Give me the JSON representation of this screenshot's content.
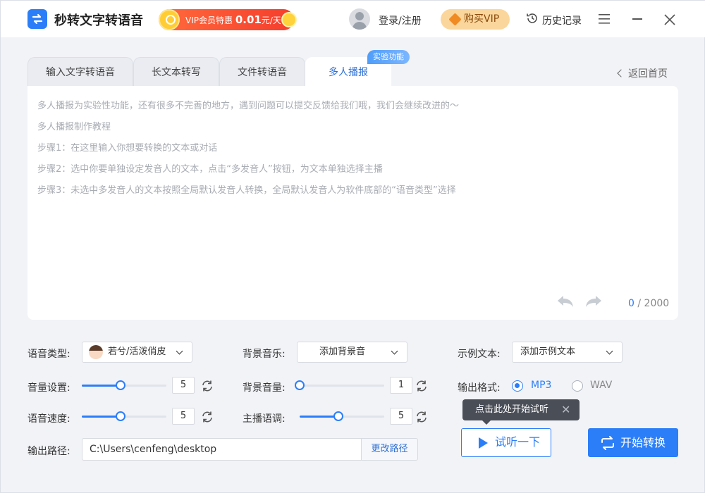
{
  "app": {
    "title": "秒转文字转语音",
    "promo_prefix": "VIP会员特惠",
    "promo_price": "0.01",
    "promo_suffix": "元/天",
    "login": "登录/注册",
    "buy_vip": "购买VIP",
    "history": "历史记录"
  },
  "tabs": [
    {
      "label": "输入文字转语音"
    },
    {
      "label": "长文本转写"
    },
    {
      "label": "文件转语音"
    },
    {
      "label": "多人播报"
    }
  ],
  "badge": "实验功能",
  "back": "返回首页",
  "editor": {
    "hints": [
      "多人播报为实验性功能，还有很多不完善的地方，遇到问题可以提交反馈给我们哦，我们会继续改进的～",
      "多人播报制作教程",
      "步骤1：在这里输入你想要转换的文本或对话",
      "步骤2：选中你要单独设定发音人的文本，点击“多发音人”按钮，为文本单独选择主播",
      "步骤3：未选中多发音人的文本按照全局默认发音人转换，全局默认发音人为软件底部的“语音类型”选择"
    ],
    "count_current": "0",
    "count_sep": " / ",
    "count_max": "2000"
  },
  "settings": {
    "voice_type_label": "语音类型:",
    "voice_type_value": "若兮/活泼俏皮",
    "bg_music_label": "背景音乐:",
    "bg_music_value": "添加背景音",
    "sample_text_label": "示例文本:",
    "sample_text_value": "添加示例文本",
    "volume_label": "音量设置:",
    "volume_value": "5",
    "bg_volume_label": "背景音量:",
    "bg_volume_value": "1",
    "output_format_label": "输出格式:",
    "format_mp3": "MP3",
    "format_wav": "WAV",
    "speed_label": "语音速度:",
    "speed_value": "5",
    "pitch_label": "主播语调:",
    "pitch_value": "5",
    "output_path_label": "输出路径:",
    "output_path_value": "C:\\Users\\cenfeng\\desktop",
    "change_path": "更改路径"
  },
  "sliders": {
    "volume": 0.45,
    "bg_volume": 0.0,
    "speed": 0.45,
    "pitch": 0.45
  },
  "tooltip": "点击此处开始试听",
  "buttons": {
    "preview": "试听一下",
    "convert": "开始转换"
  },
  "colors": {
    "accent": "#2b7ef8",
    "vip_gold": "#fbd69c",
    "promo_red": "#f53d2d"
  }
}
